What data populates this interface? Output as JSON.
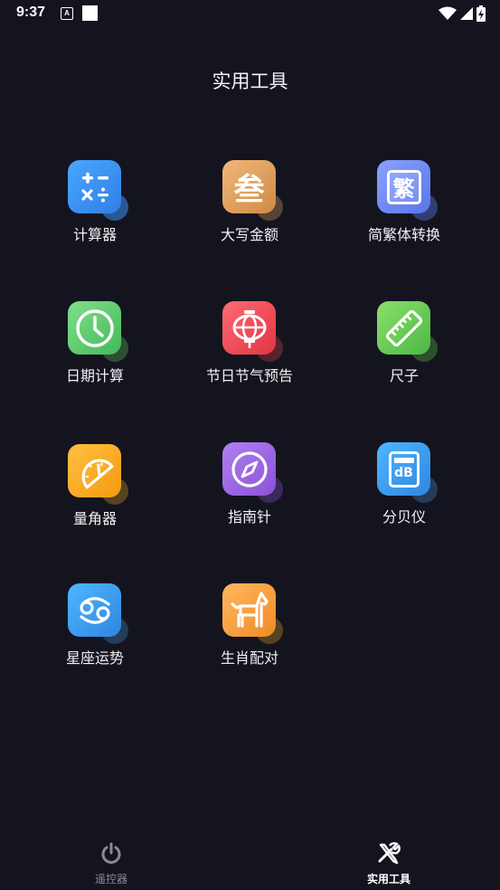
{
  "status_bar": {
    "time": "9:37",
    "a_icon": "A"
  },
  "header": {
    "title": "实用工具"
  },
  "tools": [
    {
      "label": "计算器",
      "icon": "calculator-icon",
      "color": "#3b8ff0"
    },
    {
      "label": "大写金额",
      "icon": "currency-icon",
      "glyph": "叁",
      "color": "#e0a460"
    },
    {
      "label": "简繁体转换",
      "icon": "traditional-chinese-icon",
      "glyph": "繁",
      "color": "#6b86f0"
    },
    {
      "label": "日期计算",
      "icon": "clock-icon",
      "color": "#5dcc6e"
    },
    {
      "label": "节日节气预告",
      "icon": "lantern-icon",
      "color": "#f04a57"
    },
    {
      "label": "尺子",
      "icon": "ruler-icon",
      "color": "#6fd05a"
    },
    {
      "label": "量角器",
      "icon": "protractor-icon",
      "color": "#f5a623"
    },
    {
      "label": "指南针",
      "icon": "compass-icon",
      "color": "#9a62e0"
    },
    {
      "label": "分贝仪",
      "icon": "decibel-icon",
      "glyph": "dB",
      "color": "#3a9ce8"
    },
    {
      "label": "星座运势",
      "icon": "cancer-zodiac-icon",
      "color": "#3a9ce8"
    },
    {
      "label": "生肖配对",
      "icon": "horse-icon",
      "color": "#f5a623"
    }
  ],
  "bottom_nav": [
    {
      "label": "遥控器",
      "icon": "power-icon",
      "active": false
    },
    {
      "label": "实用工具",
      "icon": "tools-icon",
      "active": true
    }
  ]
}
